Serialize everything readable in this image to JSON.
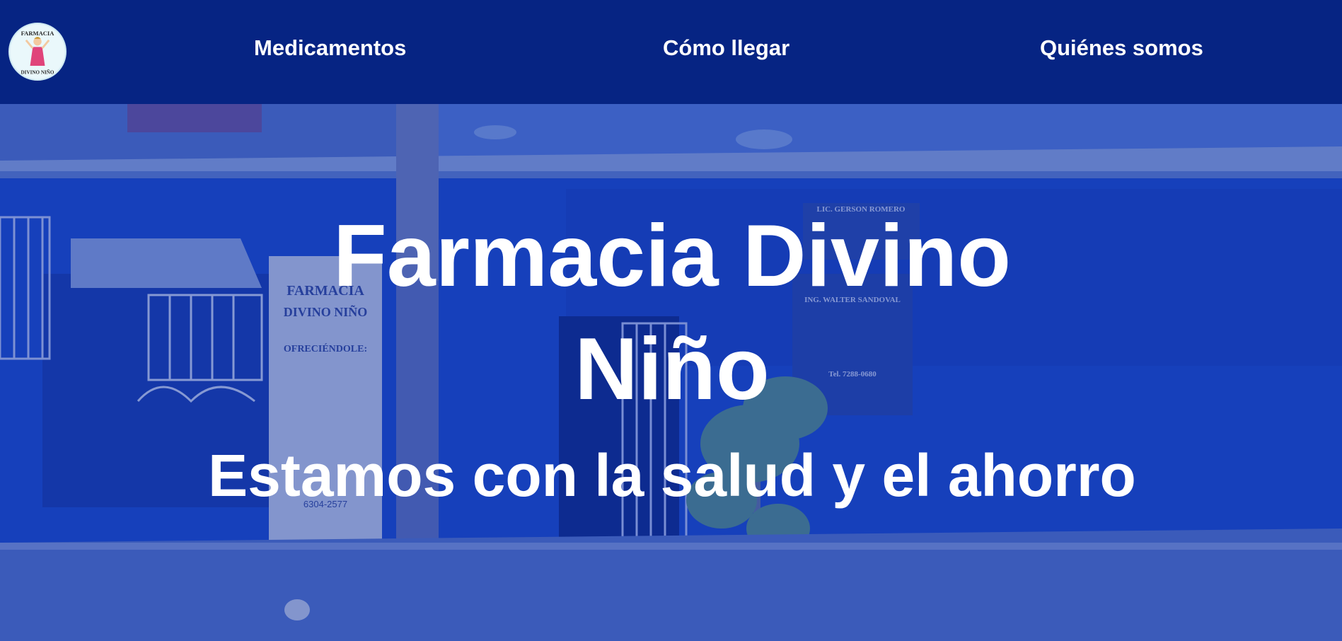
{
  "header": {
    "logo": {
      "icon": "pharmacy-logo-icon",
      "text_top": "FARMACIA",
      "text_bottom": "DIVINO NIÑO"
    },
    "nav": [
      {
        "label": "Medicamentos"
      },
      {
        "label": "Cómo llegar"
      },
      {
        "label": "Quiénes somos"
      }
    ]
  },
  "hero": {
    "title": "Farmacia Divino Niño",
    "subtitle": "Estamos con la salud y el ahorro",
    "background": "storefront-photo",
    "sign_left": {
      "line1": "FARMACIA",
      "line2": "DIVINO NIÑO",
      "line3": "OFRECIÉNDOLE:",
      "phone": "6304-2577"
    },
    "sign_right": {
      "name1": "LIC. GERSON ROMERO",
      "name2": "ING. WALTER SANDOVAL",
      "phone": "Tel. 7288-0680"
    }
  },
  "colors": {
    "header_bg": "#062483",
    "hero_tint": "#1f4fd0",
    "text": "#ffffff"
  }
}
